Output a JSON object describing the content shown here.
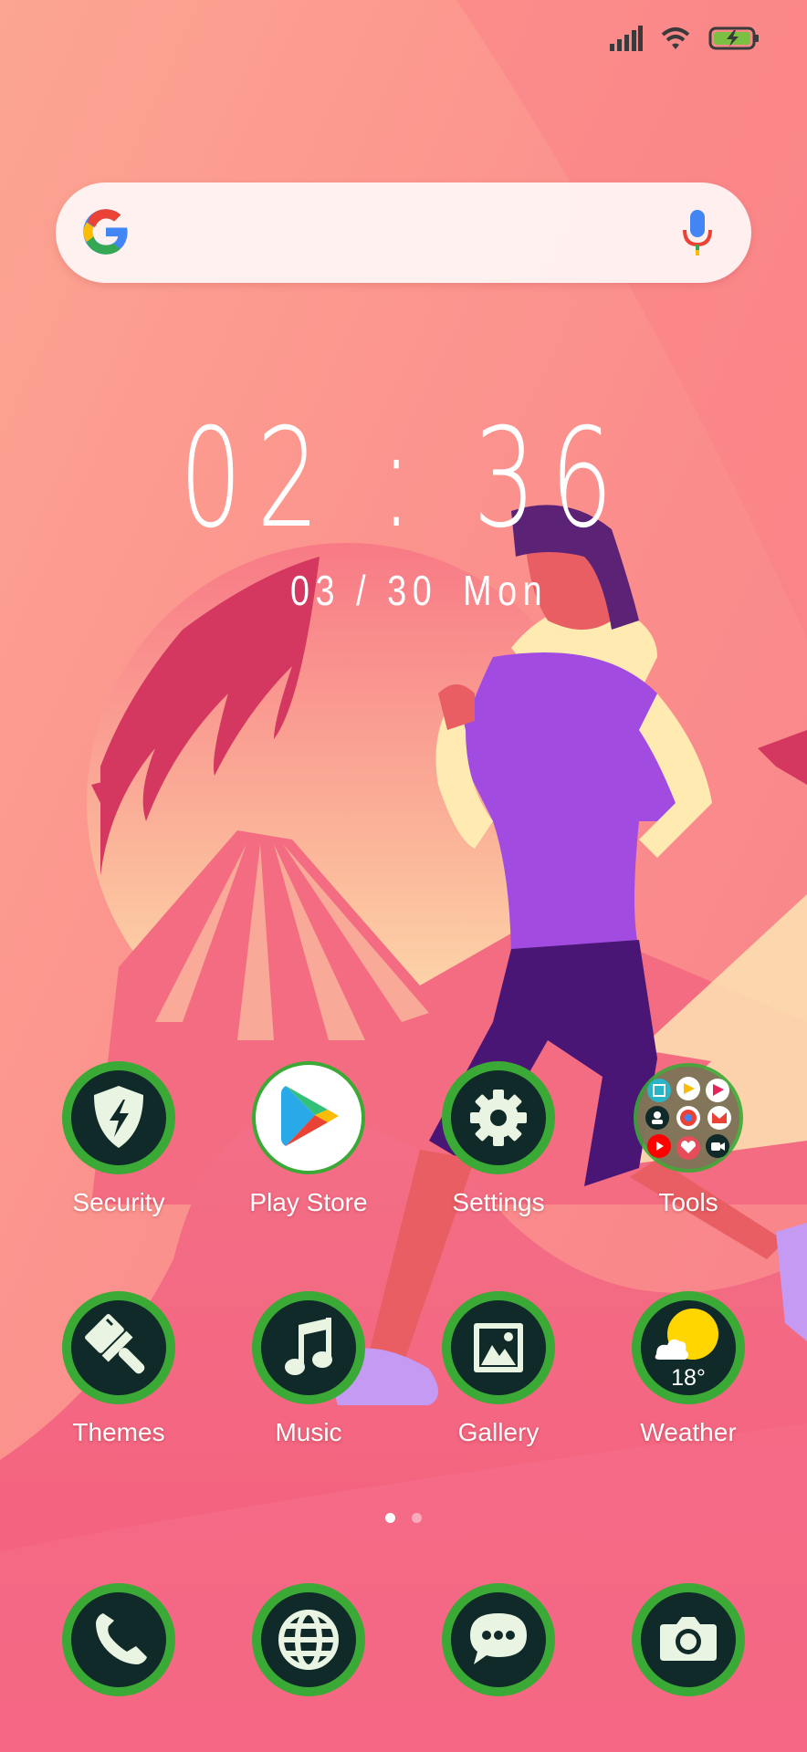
{
  "status_bar": {
    "icons": [
      "signal-icon",
      "wifi-icon",
      "battery-charging-icon"
    ],
    "battery_color": "#7bc043"
  },
  "search": {
    "icons": [
      "google-logo-icon",
      "microphone-icon"
    ]
  },
  "clock": {
    "time": "02 : 36",
    "date": "03 / 30",
    "weekday": "Mon"
  },
  "apps_row1": [
    {
      "label": "Security",
      "icon": "shield-lightning-icon"
    },
    {
      "label": "Play Store",
      "icon": "play-store-icon"
    },
    {
      "label": "Settings",
      "icon": "gear-icon"
    },
    {
      "label": "Tools",
      "icon": "folder-icon"
    }
  ],
  "apps_row2": [
    {
      "label": "Themes",
      "icon": "paintbrush-icon"
    },
    {
      "label": "Music",
      "icon": "music-note-icon"
    },
    {
      "label": "Gallery",
      "icon": "image-icon"
    },
    {
      "label": "Weather",
      "icon": "sun-cloud-icon",
      "temperature": "18°"
    }
  ],
  "dock": [
    {
      "icon": "phone-icon"
    },
    {
      "icon": "globe-icon"
    },
    {
      "icon": "chat-bubble-icon"
    },
    {
      "icon": "camera-icon"
    }
  ],
  "page_indicator": {
    "pages": 2,
    "current": 1
  },
  "colors": {
    "icon_ring": "#3aa935",
    "icon_inner": "#0f2a28",
    "glyph": "#e9f5e2",
    "background_top": "#fb9a8c",
    "background_bottom": "#f76f84"
  }
}
